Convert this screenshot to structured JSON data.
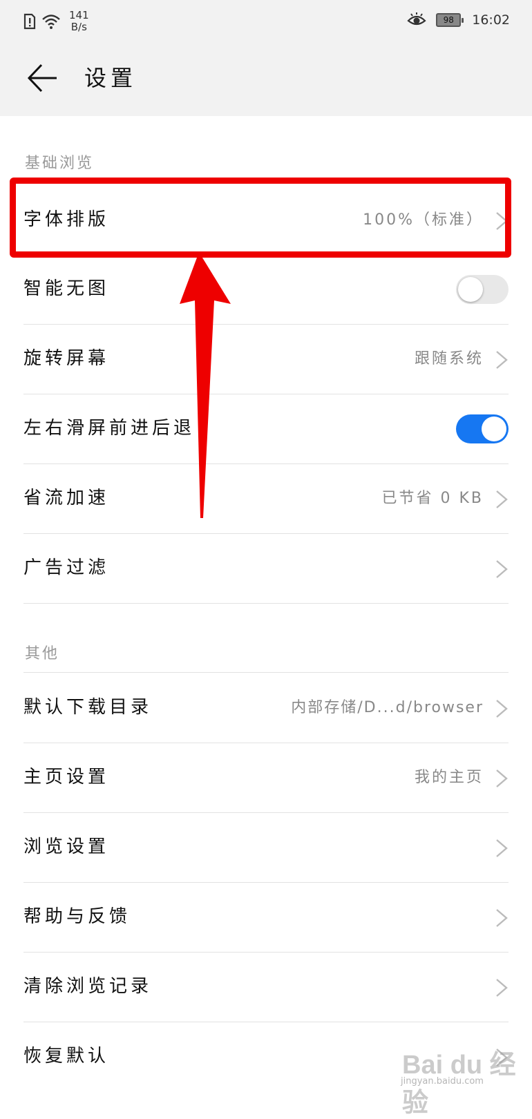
{
  "status_bar": {
    "net_speed_value": "141",
    "net_speed_unit": "B/s",
    "battery_level": "98",
    "time": "16:02"
  },
  "header": {
    "title": "设置"
  },
  "sections": {
    "basic": {
      "title": "基础浏览",
      "items": [
        {
          "label": "字体排版",
          "value": "100%（标准）"
        },
        {
          "label": "智能无图",
          "toggle": "off"
        },
        {
          "label": "旋转屏幕",
          "value": "跟随系统"
        },
        {
          "label": "左右滑屏前进后退",
          "toggle": "on"
        },
        {
          "label": "省流加速",
          "value": "已节省 0 KB"
        },
        {
          "label": "广告过滤"
        }
      ]
    },
    "other": {
      "title": "其他",
      "items": [
        {
          "label": "默认下载目录",
          "value": "内部存储/D...d/browser"
        },
        {
          "label": "主页设置",
          "value": "我的主页"
        },
        {
          "label": "浏览设置"
        },
        {
          "label": "帮助与反馈"
        },
        {
          "label": "清除浏览记录"
        },
        {
          "label": "恢复默认"
        }
      ]
    }
  },
  "watermark": {
    "text": "Bai du 经验",
    "subtext": "jingyan.baidu.com"
  },
  "colors": {
    "accent": "#1677f2",
    "highlight": "#ee0000",
    "header_bg": "#f2f2f2"
  }
}
